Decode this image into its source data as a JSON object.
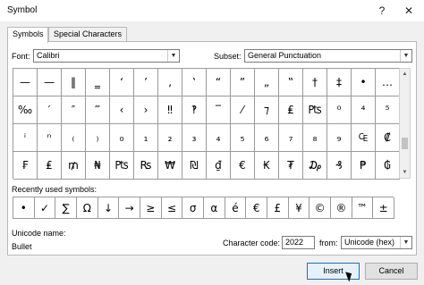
{
  "window": {
    "title": "Symbol",
    "help_glyph": "?",
    "close_glyph": "✕"
  },
  "tabs": [
    {
      "label": "Symbols",
      "active": true
    },
    {
      "label": "Special Characters",
      "active": false
    }
  ],
  "font": {
    "label": "Font:",
    "value": "Calibri"
  },
  "subset": {
    "label": "Subset:",
    "value": "General Punctuation"
  },
  "grid": {
    "selected_row": 0,
    "selected_col": 16,
    "rows": [
      [
        "—",
        "—",
        "‖",
        "‗",
        "‘",
        "’",
        "‚",
        "‛",
        "“",
        "”",
        "„",
        "‟",
        "†",
        "‡",
        "•",
        "…"
      ],
      [
        "‰",
        "′",
        "″",
        "‴",
        "‹",
        "›",
        "‼",
        "‽",
        "‾",
        "⁄",
        "⁊",
        "₤",
        "₧",
        "⁰",
        "⁴",
        "⁵"
      ],
      [
        "ⁱ",
        "ⁿ",
        "₍",
        "₎",
        "₀",
        "₁",
        "₂",
        "₃",
        "₄",
        "₅",
        "₆",
        "₇",
        "₈",
        "₉",
        "₠",
        "₡"
      ],
      [
        "₣",
        "₤",
        "₥",
        "₦",
        "₧",
        "₨",
        "₩",
        "₪",
        "₫",
        "€",
        "₭",
        "₮",
        "₯",
        "₰",
        "₱",
        "₲"
      ]
    ]
  },
  "recent": {
    "label": "Recently used symbols:",
    "symbols": [
      "•",
      "✓",
      "∑",
      "Ω",
      "↓",
      "→",
      "≥",
      "≤",
      "σ",
      "α",
      "é",
      "€",
      "£",
      "¥",
      "©",
      "®",
      "™",
      "±"
    ]
  },
  "unicode_name": {
    "label": "Unicode name:",
    "value": "Bullet"
  },
  "character_code": {
    "label": "Character code:",
    "value": "2022"
  },
  "from": {
    "label": "from:",
    "value": "Unicode (hex)"
  },
  "buttons": {
    "insert": "Insert",
    "cancel": "Cancel"
  },
  "colors": {
    "selection": "#0078d7",
    "default_button_border": "#0078d7"
  }
}
